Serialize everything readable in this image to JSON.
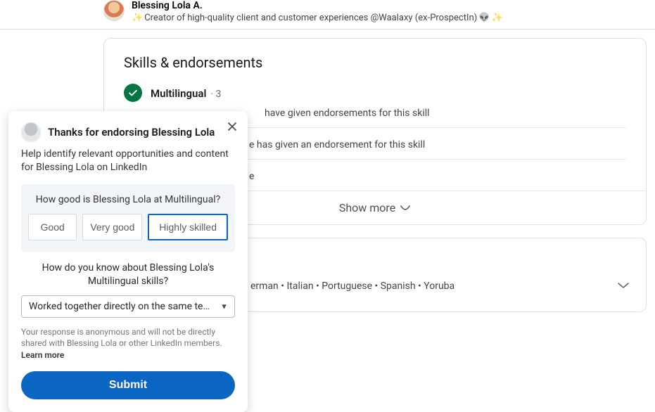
{
  "header": {
    "name": "Blessing Lola A.",
    "tagline": "Creator of high-quality client and customer experiences @Waalaxy (ex-ProspectIn)"
  },
  "skills": {
    "title": "Skills & endorsements",
    "items": [
      {
        "label": "Multilingual",
        "count": "· 3",
        "endorsement_line": "have given endorsements for this skill"
      },
      {
        "endorsement_line": "has given an endorsement for this skill"
      }
    ],
    "isolated_letter": "e",
    "show_more": "Show more"
  },
  "languages": {
    "line": "erman  •  Italian  •  Portuguese  •  Spanish  •  Yoruba"
  },
  "modal": {
    "title": "Thanks for endorsing Blessing Lola",
    "subtitle": "Help identify relevant opportunities and content for Blessing Lola on LinkedIn",
    "q1": "How good is Blessing Lola at Multilingual?",
    "options": {
      "good": "Good",
      "very_good": "Very good",
      "highly_skilled": "Highly skilled"
    },
    "q2": "How do you know about Blessing Lola's Multilingual skills?",
    "select_value": "Worked together directly on the same team or project",
    "disclaimer": "Your response is anonymous and will not be directly shared with Blessing Lola or other LinkedIn members. ",
    "learn_more": "Learn more",
    "submit": "Submit"
  }
}
